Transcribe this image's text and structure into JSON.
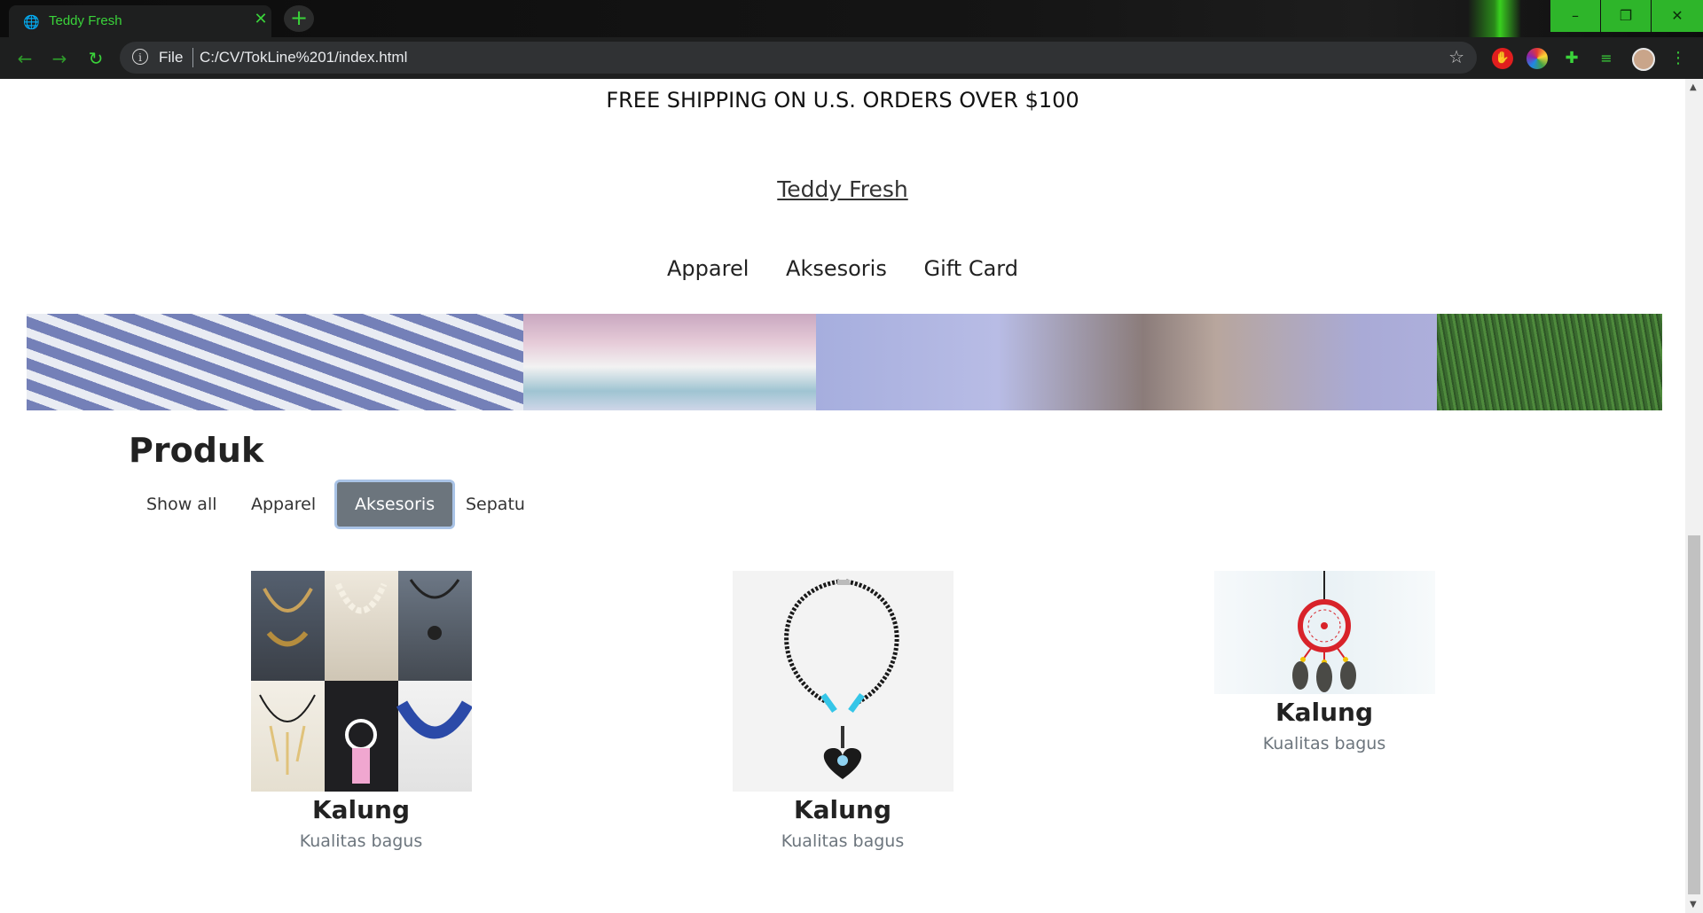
{
  "browser": {
    "tab_title": "Teddy Fresh",
    "tab_close": "✕",
    "new_tab": "+",
    "url_scheme": "File",
    "url": "C:/CV/TokLine%201/index.html",
    "window_controls": [
      "–",
      "❐",
      "✕"
    ]
  },
  "site": {
    "promo": "FREE SHIPPING ON U.S. ORDERS OVER $100",
    "brand": "Teddy Fresh",
    "nav": [
      "Apparel",
      "Aksesoris",
      "Gift Card"
    ]
  },
  "products": {
    "heading": "Produk",
    "filters": [
      {
        "label": "Show all",
        "active": false
      },
      {
        "label": "Apparel",
        "active": false
      },
      {
        "label": "Aksesoris",
        "active": true
      },
      {
        "label": "Sepatu",
        "active": false
      }
    ],
    "items": [
      {
        "name": "Kalung",
        "desc": "Kualitas bagus"
      },
      {
        "name": "Kalung",
        "desc": "Kualitas bagus"
      },
      {
        "name": "Kalung",
        "desc": "Kualitas bagus"
      }
    ]
  },
  "colors": {
    "accent_green": "#3ad33a",
    "active_filter_bg": "#6c757d",
    "active_filter_border": "#a9c3e6"
  }
}
